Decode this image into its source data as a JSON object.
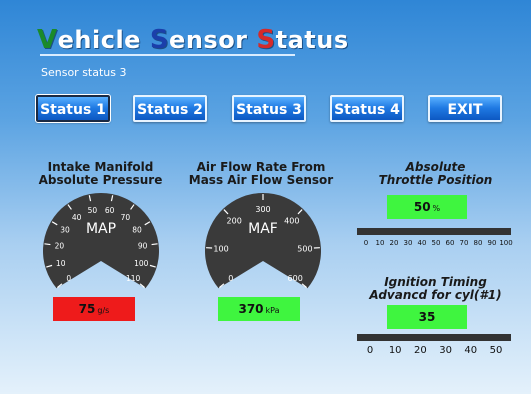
{
  "window": {
    "title_parts": [
      {
        "initial": "V",
        "rest": "ehicle",
        "color": "#1a8a2a"
      },
      {
        "initial": "S",
        "rest": "ensor",
        "color": "#1b3faa"
      },
      {
        "initial": "S",
        "rest": "tatus",
        "color": "#d42a2a"
      }
    ],
    "subtitle": "Sensor status 3"
  },
  "nav": {
    "buttons": [
      {
        "label": "Status 1",
        "active": true
      },
      {
        "label": "Status 2",
        "active": false
      },
      {
        "label": "Status 3",
        "active": false
      },
      {
        "label": "Status 4",
        "active": false
      },
      {
        "label": "EXIT",
        "active": false
      }
    ]
  },
  "map_gauge": {
    "title_line1": "Intake Manifold",
    "title_line2": "Absolute Pressure",
    "dial_label": "MAP",
    "ticks": [
      "0",
      "10",
      "20",
      "30",
      "40",
      "50",
      "60",
      "70",
      "80",
      "90",
      "100",
      "110"
    ],
    "value": "75",
    "unit": "g/s",
    "box_color": "#ee1b1b"
  },
  "maf_gauge": {
    "title_line1": "Air Flow Rate From",
    "title_line2": "Mass Air Flow Sensor",
    "dial_label": "MAF",
    "ticks": [
      "0",
      "100",
      "200",
      "300",
      "400",
      "500",
      "600"
    ],
    "value": "370",
    "unit": "kPa",
    "box_color": "#3ff53f"
  },
  "throttle": {
    "title_line1": "Absolute",
    "title_line2": "Throttle Position",
    "value": "50",
    "unit": "%",
    "ticks": [
      "0",
      "10",
      "20",
      "30",
      "40",
      "50",
      "60",
      "70",
      "80",
      "90",
      "100"
    ]
  },
  "ignition": {
    "title_line1": "Ignition Timing",
    "title_line2": "Advancd for cyl(#1)",
    "value": "35",
    "ticks": [
      "0",
      "10",
      "20",
      "30",
      "40",
      "50"
    ]
  },
  "colors": {
    "dial": "#3a3a3a",
    "green_value": "#3ff53f",
    "red_value": "#ee1b1b"
  }
}
